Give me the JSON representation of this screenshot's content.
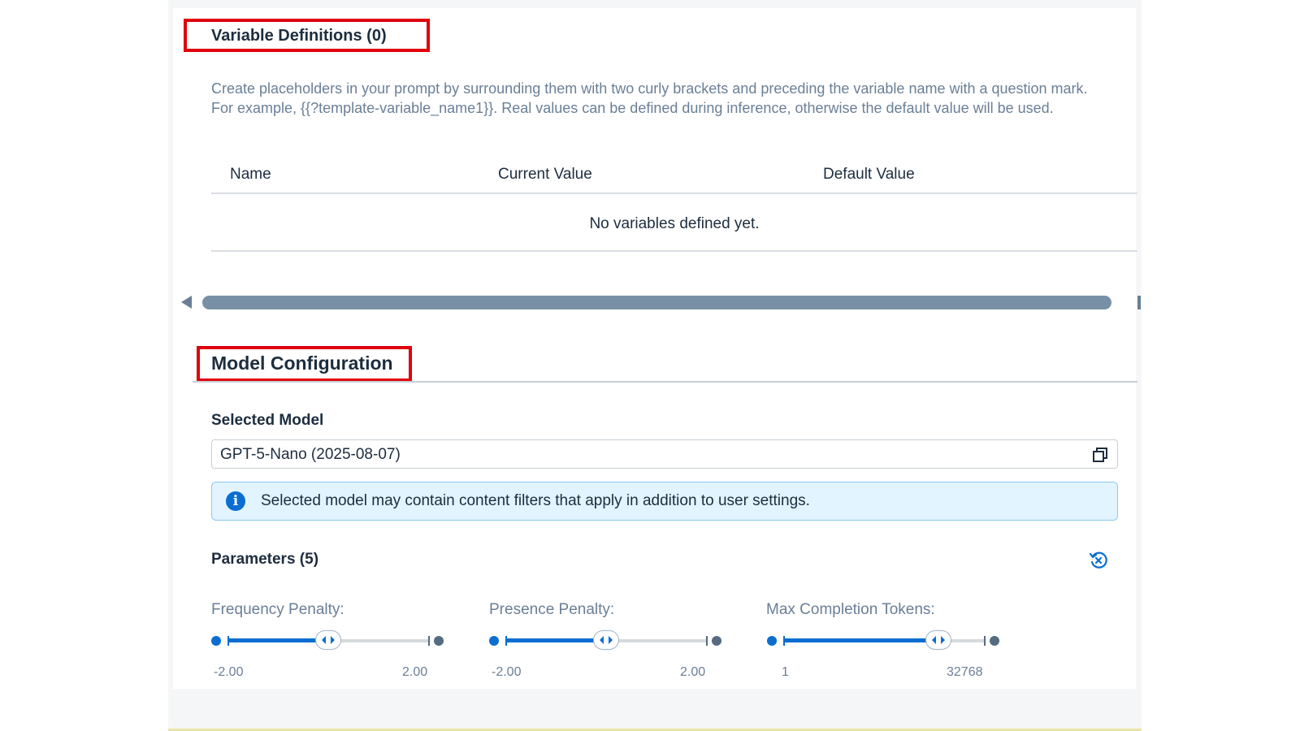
{
  "variable_definitions": {
    "title": "Variable Definitions (0)",
    "description": "Create placeholders in your prompt by surrounding them with two curly brackets and preceding the variable name with a question mark. For example, {{?template-variable_name1}}. Real values can be defined during inference, otherwise the default value will be used.",
    "columns": [
      "Name",
      "Current Value",
      "Default Value"
    ],
    "empty_message": "No variables defined yet."
  },
  "model_configuration": {
    "title": "Model Configuration",
    "selected_model_label": "Selected Model",
    "selected_model_value": "GPT-5-Nano (2025-08-07)",
    "info_message": "Selected model may contain content filters that apply in addition to user settings."
  },
  "parameters": {
    "title": "Parameters (5)",
    "sliders": [
      {
        "label": "Frequency Penalty:",
        "min": "-2.00",
        "max": "2.00",
        "level": 0.5
      },
      {
        "label": "Presence Penalty:",
        "min": "-2.00",
        "max": "2.00",
        "level": 0.5
      },
      {
        "label": "Max Completion Tokens:",
        "min": "1",
        "max": "32768",
        "level": 0.77
      }
    ]
  },
  "colors": {
    "highlight": "#e0000b",
    "accent": "#0a6ed1"
  },
  "icons": {
    "model_picker": "copy-icon",
    "info": "info-icon",
    "reset": "reset-icon"
  }
}
